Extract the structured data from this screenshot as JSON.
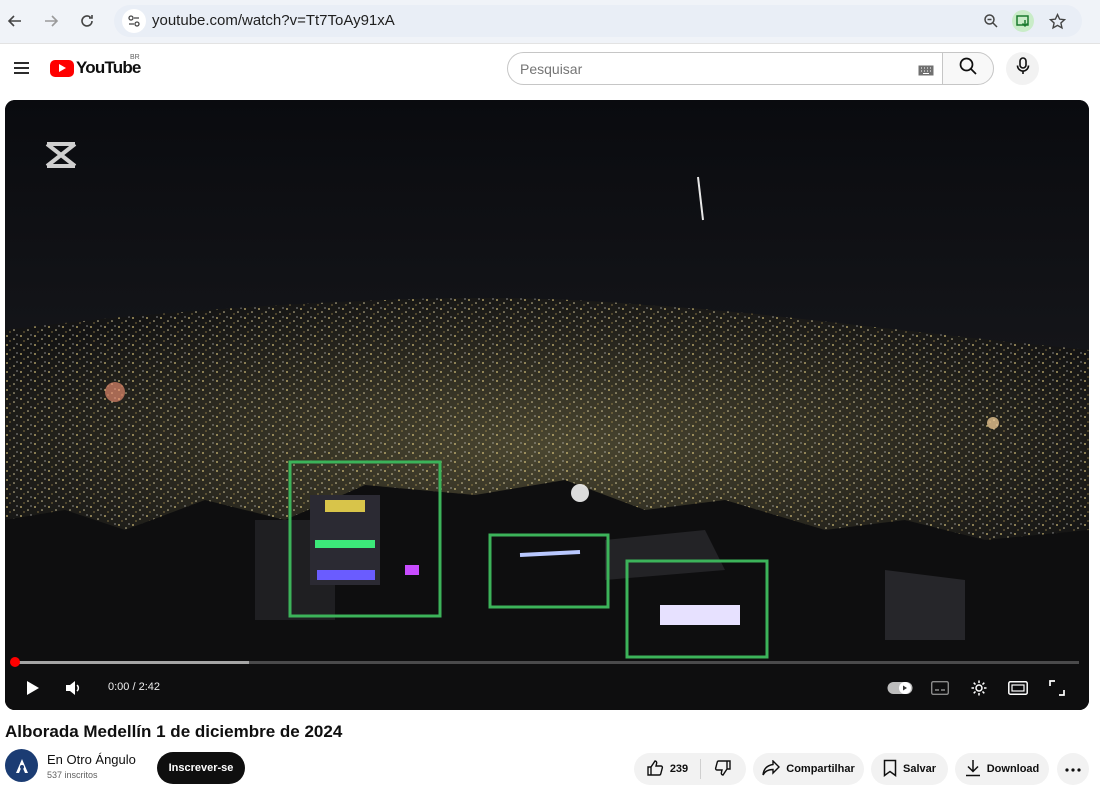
{
  "browser": {
    "url": "youtube.com/watch?v=Tt7ToAy91xA",
    "icons": [
      "back-icon",
      "forward-icon",
      "reload-icon",
      "site-info-icon",
      "zoom-icon",
      "install-app-icon",
      "bookmark-star-icon"
    ]
  },
  "header": {
    "logo_text": "YouTube",
    "country_code": "BR",
    "search_placeholder": "Pesquisar",
    "icons": [
      "menu-icon",
      "keyboard-icon",
      "search-icon",
      "mic-icon"
    ]
  },
  "player": {
    "time_display": "0:00 / 2:42",
    "played_fraction": 0.0,
    "buffered_fraction": 0.22,
    "controls": [
      "play-icon",
      "volume-icon",
      "autoplay-toggle-icon",
      "subtitles-icon",
      "settings-icon",
      "theater-mode-icon",
      "fullscreen-icon"
    ],
    "watermark": "capcut-logo"
  },
  "video": {
    "title": "Alborada Medellín 1 de diciembre de 2024",
    "channel_name": "En Otro Ángulo",
    "subscribers": "537 inscritos",
    "subscribe_label": "Inscrever-se",
    "like_count": "239",
    "share_label": "Compartilhar",
    "save_label": "Salvar",
    "download_label": "Download"
  },
  "colors": {
    "brand_red": "#ff0000",
    "highlight_box": "#3cb35a",
    "progress_red": "#ff0000"
  }
}
